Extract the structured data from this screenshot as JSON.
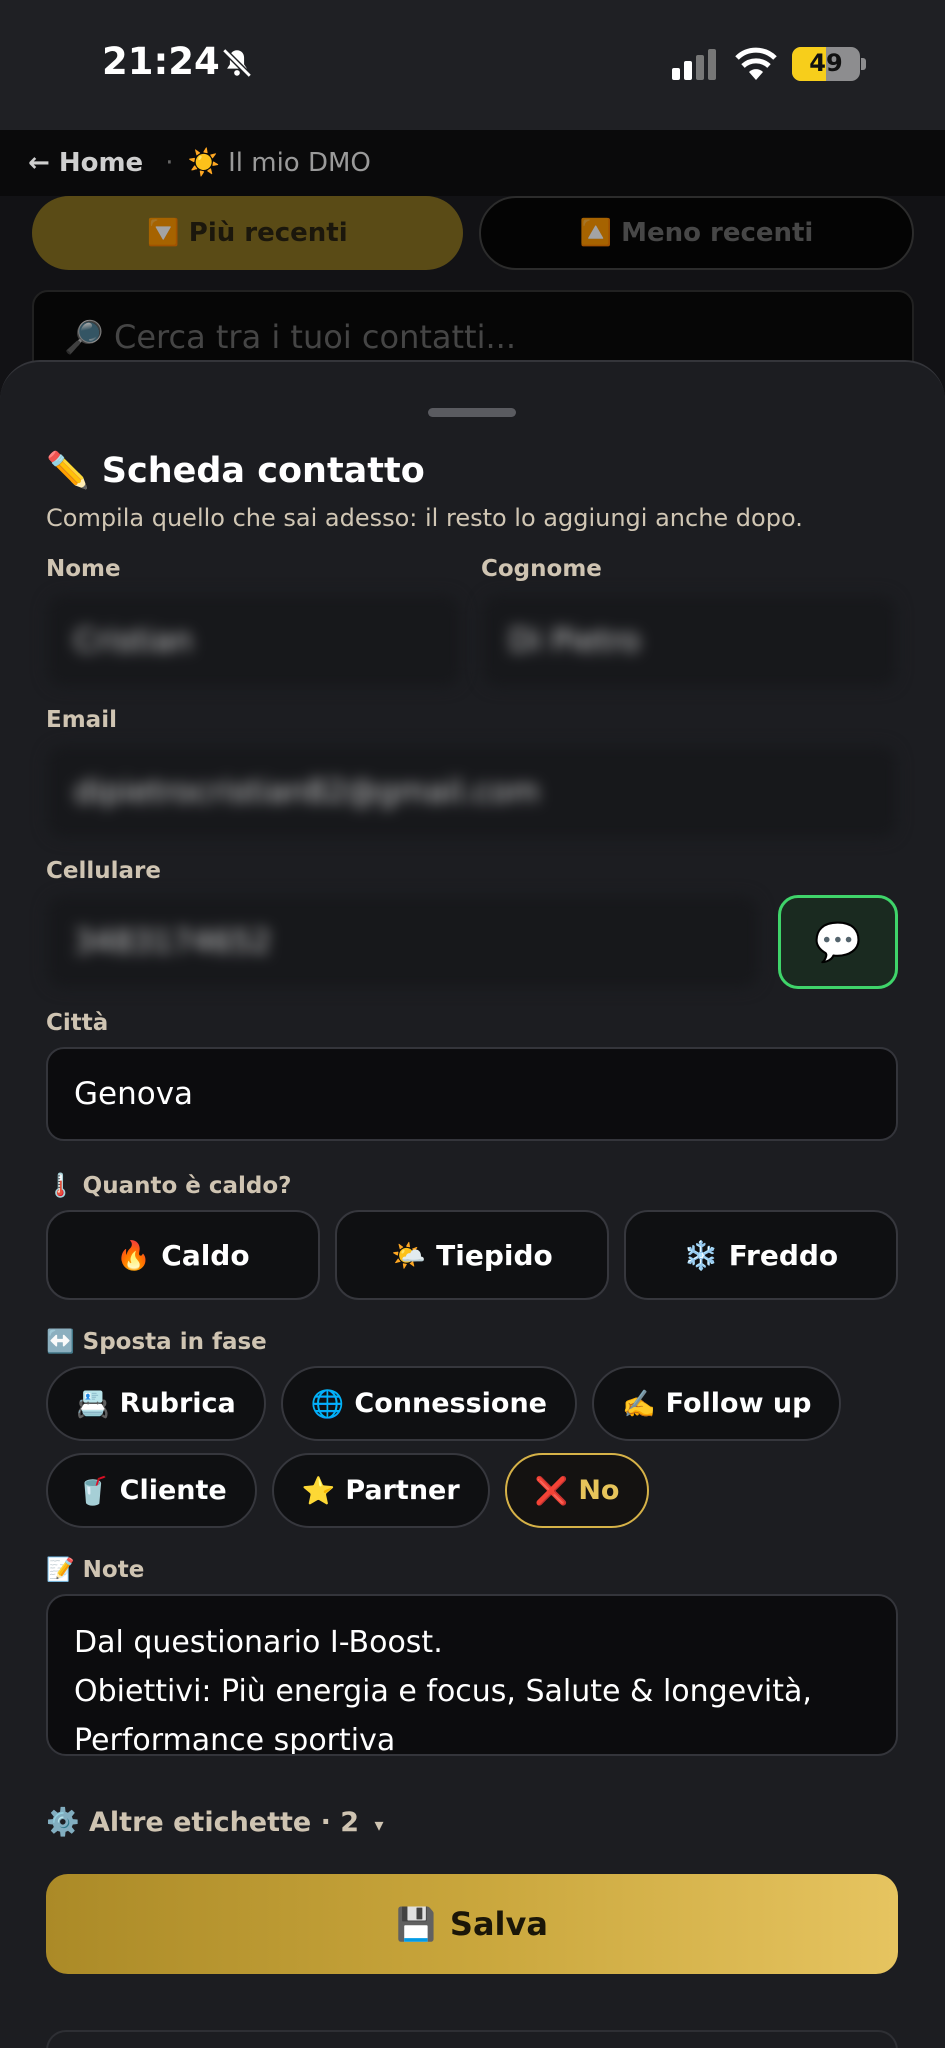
{
  "status": {
    "time": "21:24",
    "battery": "49"
  },
  "nav": {
    "back": "← Home",
    "separator": "·",
    "current": "☀️ Il mio DMO"
  },
  "background": {
    "sort_recent": "🔽 Più recenti",
    "sort_oldest": "🔼 Meno recenti",
    "search_placeholder": "🔎 Cerca tra i tuoi contatti..."
  },
  "sheet": {
    "title": "✏️ Scheda contatto",
    "subtitle": "Compila quello che sai adesso: il resto lo aggiungi anche dopo.",
    "labels": {
      "first_name": "Nome",
      "last_name": "Cognome",
      "email": "Email",
      "mobile": "Cellulare",
      "city": "Città",
      "temperature": "🌡️ Quanto è caldo?",
      "stage": "↔️ Sposta in fase",
      "notes": "📝 Note"
    },
    "fields": {
      "first_name": "Cristian",
      "last_name": "Di Pietro",
      "email": "dipietrocristian82@gmail.com",
      "mobile": "3483174652",
      "city": "Genova"
    },
    "message_icon": "💬",
    "temperature_options": [
      {
        "icon": "🔥",
        "label": "Caldo"
      },
      {
        "icon": "🌤️",
        "label": "Tiepido"
      },
      {
        "icon": "❄️",
        "label": "Freddo"
      }
    ],
    "stages": [
      {
        "icon": "📇",
        "label": "Rubrica"
      },
      {
        "icon": "🌐",
        "label": "Connessione"
      },
      {
        "icon": "✍️",
        "label": "Follow up"
      },
      {
        "icon": "🥤",
        "label": "Cliente"
      },
      {
        "icon": "⭐",
        "label": "Partner"
      },
      {
        "icon": "❌",
        "label": "No"
      }
    ],
    "selected_stage": "No",
    "notes_line1": "Dal questionario I-Boost.",
    "notes_line2": "Obiettivi: Più energia e focus, Salute & longevità,",
    "notes_line3": "Performance sportiva",
    "more_tags": "⚙️ Altre etichette · 2",
    "more_caret": "▾",
    "save_icon": "💾",
    "save_label": "Salva"
  },
  "colors": {
    "accent": "#d6b248",
    "success": "#3fd46a",
    "background": "#1c1d21"
  }
}
